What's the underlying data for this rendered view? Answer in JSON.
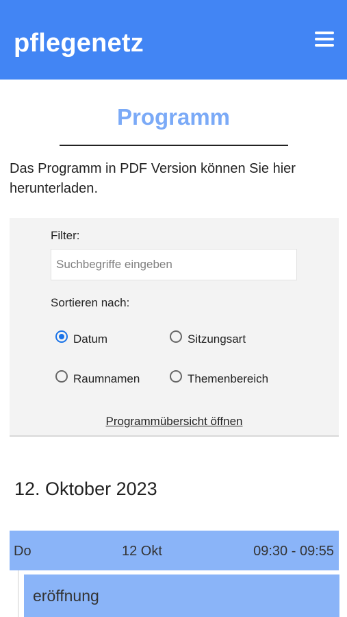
{
  "header": {
    "brand": "pflegenetz",
    "menu_icon": "hamburger-menu-icon",
    "background_color": "#4285f4"
  },
  "page": {
    "title": "Programm",
    "intro_text": "Das Programm in PDF Version können Sie hier",
    "intro_link": "herunterladen",
    "intro_end": "."
  },
  "filter": {
    "label": "Filter:",
    "search_value": "",
    "search_placeholder": "Suchbegriffe eingeben",
    "sort_label": "Sortieren nach:",
    "sort_options": [
      {
        "label": "Datum",
        "checked": true
      },
      {
        "label": "Sitzungsart",
        "checked": false
      },
      {
        "label": "Raumnamen",
        "checked": false
      },
      {
        "label": "Themenbereich",
        "checked": false
      }
    ],
    "overview_link": "Programmübersicht öffnen"
  },
  "program": {
    "date_heading": "12. Oktober 2023",
    "sessions": [
      {
        "weekday": "Do",
        "date": "12 Okt",
        "time": "09:30 - 09:55",
        "title": "eröffnung"
      }
    ]
  },
  "colors": {
    "accent": "#4285f4",
    "title_light_blue": "#7baaf7",
    "session_blue": "#8ab4f8",
    "radio_checked": "#1a73e8"
  }
}
